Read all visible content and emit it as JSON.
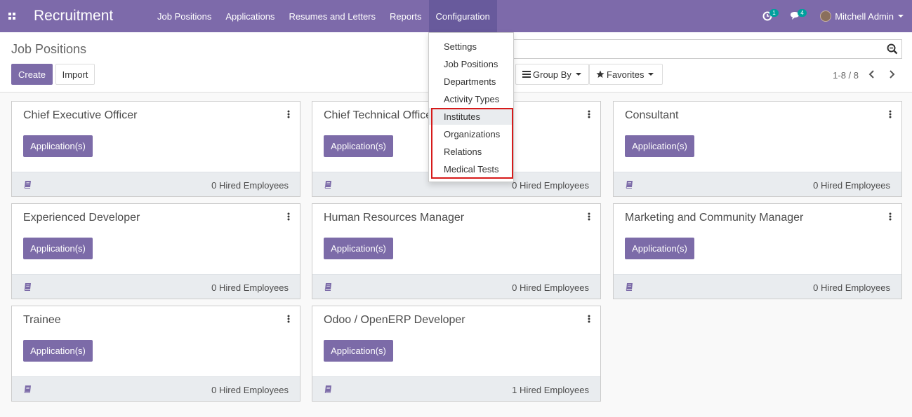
{
  "navbar": {
    "app_title": "Recruitment",
    "menu": [
      "Job Positions",
      "Applications",
      "Resumes and Letters",
      "Reports",
      "Configuration"
    ],
    "activity_count": "1",
    "message_count": "4",
    "user_name": "Mitchell Admin",
    "colors": {
      "brand": "#7c6ba8",
      "badge": "#00a09d"
    }
  },
  "control_panel": {
    "title": "Job Positions",
    "create_label": "Create",
    "import_label": "Import",
    "group_by_label": "Group By",
    "favorites_label": "Favorites",
    "pager": "1-8 / 8"
  },
  "config_menu": {
    "items": [
      "Settings",
      "Job Positions",
      "Departments",
      "Activity Types",
      "Institutes",
      "Organizations",
      "Relations",
      "Medical Tests"
    ],
    "highlight_color": "#d61a1a"
  },
  "cards": [
    {
      "title": "Chief Executive Officer",
      "button": "Application(s)",
      "hired": "0 Hired Employees"
    },
    {
      "title": "Chief Technical Officer",
      "button": "Application(s)",
      "hired": "0 Hired Employees"
    },
    {
      "title": "Consultant",
      "button": "Application(s)",
      "hired": "0 Hired Employees"
    },
    {
      "title": "Experienced Developer",
      "button": "Application(s)",
      "hired": "0 Hired Employees"
    },
    {
      "title": "Human Resources Manager",
      "button": "Application(s)",
      "hired": "0 Hired Employees"
    },
    {
      "title": "Marketing and Community Manager",
      "button": "Application(s)",
      "hired": "0 Hired Employees"
    },
    {
      "title": "Trainee",
      "button": "Application(s)",
      "hired": "0 Hired Employees"
    },
    {
      "title": "Odoo / OpenERP Developer",
      "button": "Application(s)",
      "hired": "1 Hired Employees"
    }
  ]
}
